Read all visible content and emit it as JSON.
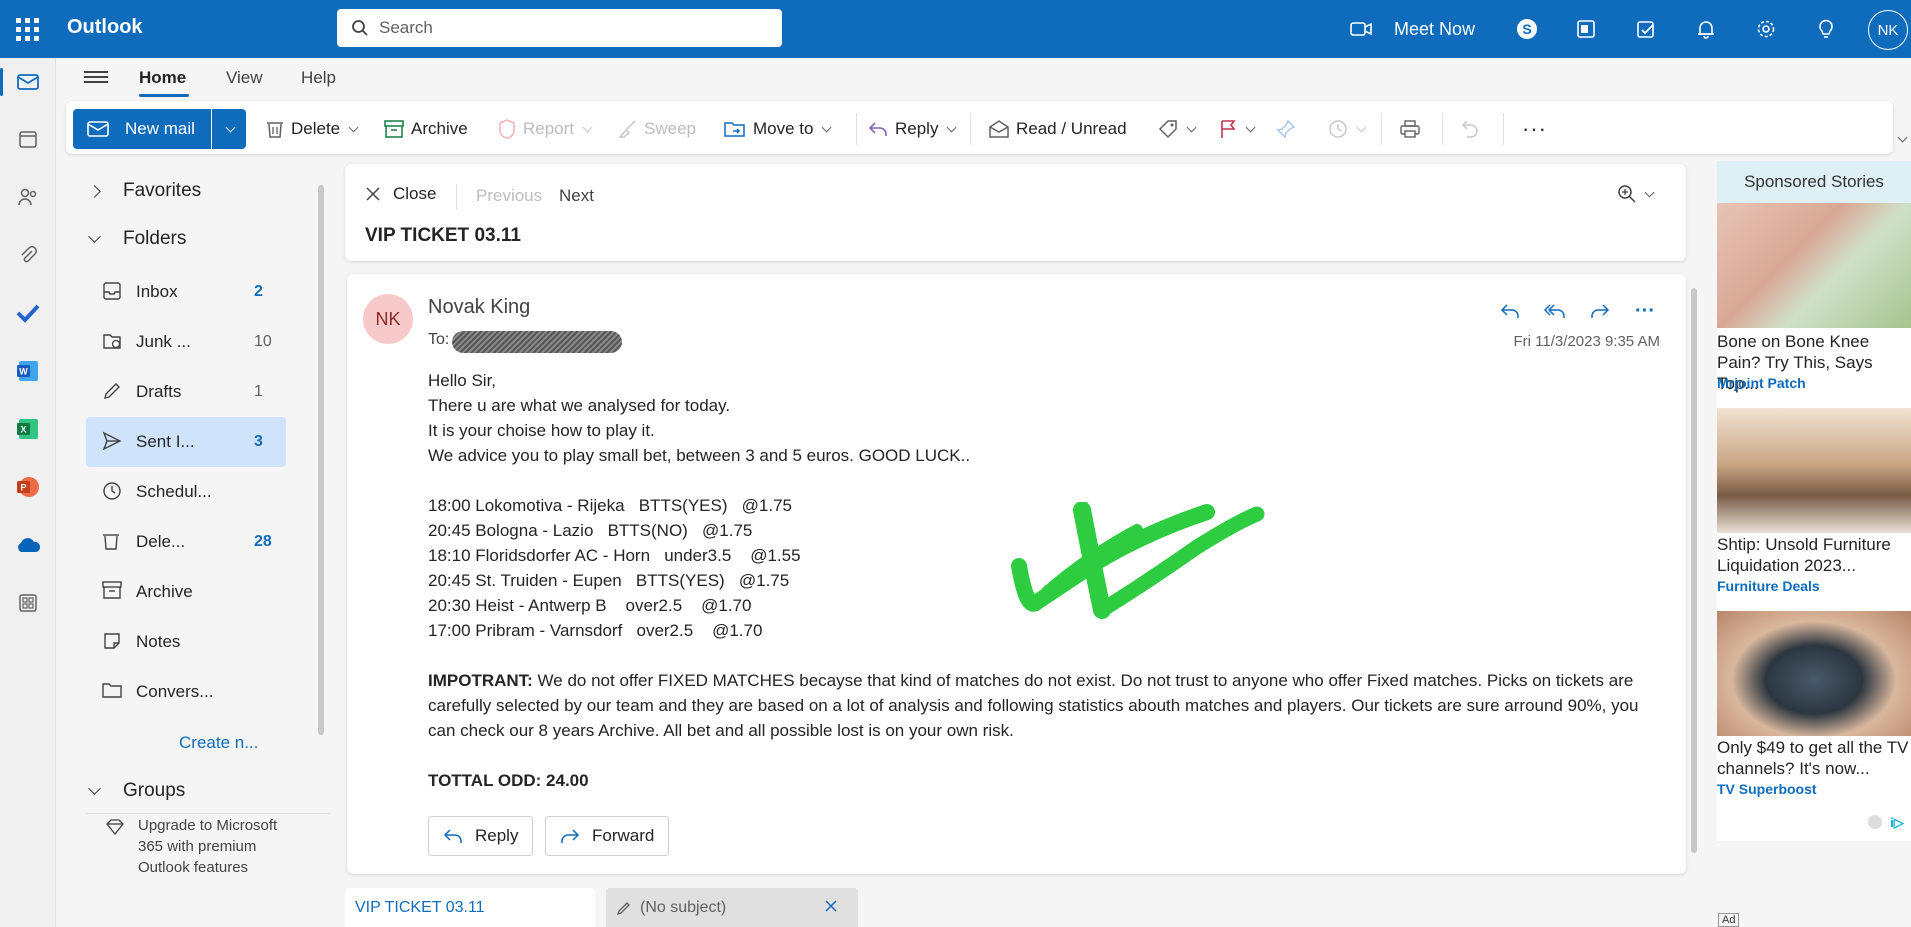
{
  "app": {
    "title": "Outlook",
    "user_initials": "NK"
  },
  "search": {
    "placeholder": "Search"
  },
  "topbar": {
    "meet_now": "Meet Now"
  },
  "tabs": [
    {
      "label": "Home"
    },
    {
      "label": "View"
    },
    {
      "label": "Help"
    }
  ],
  "ribbon": {
    "new_mail": "New mail",
    "delete": "Delete",
    "archive": "Archive",
    "report": "Report",
    "sweep": "Sweep",
    "move_to": "Move to",
    "reply": "Reply",
    "read_unread": "Read / Unread"
  },
  "folders": {
    "favorites": "Favorites",
    "folders_header": "Folders",
    "items": [
      {
        "label": "Inbox",
        "count": "2"
      },
      {
        "label": "Junk ...",
        "count": "10"
      },
      {
        "label": "Drafts",
        "count": "1"
      },
      {
        "label": "Sent I...",
        "count": "3"
      },
      {
        "label": "Schedul...",
        "count": ""
      },
      {
        "label": "Dele...",
        "count": "28"
      },
      {
        "label": "Archive",
        "count": ""
      },
      {
        "label": "Notes",
        "count": ""
      },
      {
        "label": "Convers...",
        "count": ""
      }
    ],
    "create_new": "Create n...",
    "groups": "Groups",
    "upgrade": "Upgrade to Microsoft 365 with premium Outlook features"
  },
  "reading": {
    "close": "Close",
    "previous": "Previous",
    "next": "Next",
    "subject": "VIP TICKET 03.11"
  },
  "message": {
    "avatar_initials": "NK",
    "sender": "Novak King",
    "to_label": "To:",
    "date": "Fri 11/3/2023 9:35 AM",
    "greeting": "Hello Sir,",
    "lines": [
      "There u are what we analysed for today.",
      "It is your choise how to play it.",
      "We advice you to play small bet, between 3 and 5 euros. GOOD LUCK.."
    ],
    "picks": [
      "18:00 Lokomotiva - Rijeka   BTTS(YES)   @1.75",
      "20:45 Bologna - Lazio   BTTS(NO)   @1.75",
      "18:10 Floridsdorfer AC - Horn   under3.5    @1.55",
      "20:45 St. Truiden - Eupen   BTTS(YES)   @1.75",
      "20:30 Heist - Antwerp B    over2.5    @1.70",
      "17:00 Pribram - Varnsdorf   over2.5    @1.70"
    ],
    "important_label": "IMPOTRANT:",
    "important_text": " We do not offer FIXED MATCHES becayse that kind of matches do not exist. Do not trust to anyone who offer Fixed matches. Picks on tickets are carefully selected by our team and they are based on a lot of analysis and following statistics abouth matches and players. Our tickets are sure arround 90%, you can check our 8 years Archive. All bet and all possible lost is on your own risk.",
    "total": "TOTTAL ODD: 24.00",
    "reply_button": "Reply",
    "forward_button": "Forward"
  },
  "ads": {
    "header": "Sponsored Stories",
    "items": [
      {
        "title": "Bone on Bone Knee Pain? Try This, Says Top...",
        "source": "Mrjoint Patch"
      },
      {
        "title": "Shtip: Unsold Furniture Liquidation 2023...",
        "source": "Furniture Deals"
      },
      {
        "title": "Only $49 to get all the TV channels? It's now...",
        "source": "TV Superboost"
      }
    ],
    "ad_label": "Ad"
  },
  "bottom_tabs": [
    {
      "label": "VIP TICKET 03.11"
    },
    {
      "label": "(No subject)"
    }
  ],
  "colors": {
    "brand": "#0f6cbd",
    "selected_folder": "#cfe4fa",
    "checkmark": "#2ecc40"
  }
}
